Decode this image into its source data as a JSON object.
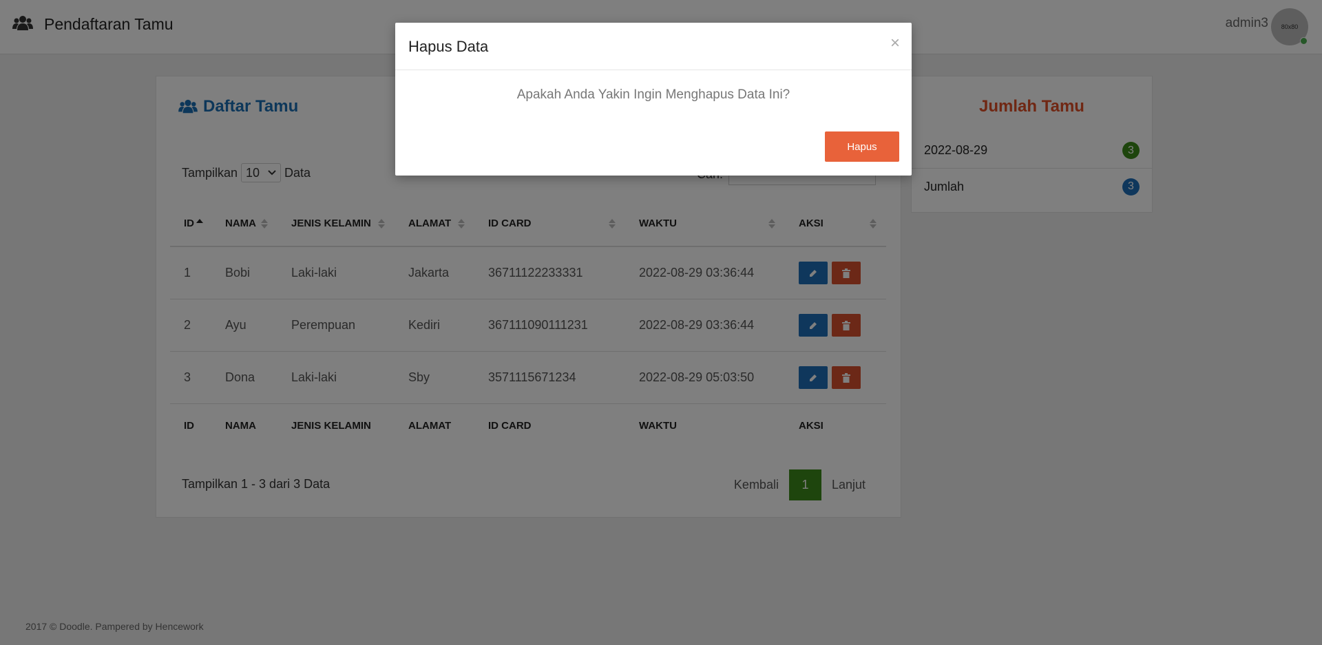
{
  "header": {
    "title": "Pendaftaran Tamu",
    "username": "admin3",
    "avatar_text": "80x80"
  },
  "main": {
    "title": "Daftar Tamu",
    "show_prefix": "Tampilkan",
    "show_value": "10",
    "show_suffix": "Data",
    "search_label": "Cari:",
    "columns": [
      "ID",
      "NAMA",
      "JENIS KELAMIN",
      "ALAMAT",
      "ID CARD",
      "WAKTU",
      "AKSI"
    ],
    "rows": [
      {
        "id": "1",
        "nama": "Bobi",
        "jk": "Laki-laki",
        "alamat": "Jakarta",
        "idcard": "36711122233331",
        "waktu": "2022-08-29 03:36:44"
      },
      {
        "id": "2",
        "nama": "Ayu",
        "jk": "Perempuan",
        "alamat": "Kediri",
        "idcard": "367111090111231",
        "waktu": "2022-08-29 03:36:44"
      },
      {
        "id": "3",
        "nama": "Dona",
        "jk": "Laki-laki",
        "alamat": "Sby",
        "idcard": "3571115671234",
        "waktu": "2022-08-29 05:03:50"
      }
    ],
    "info": "Tampilkan 1 - 3 dari 3 Data",
    "pager": {
      "prev": "Kembali",
      "current": "1",
      "next": "Lanjut"
    }
  },
  "side": {
    "title": "Jumlah Tamu",
    "items": [
      {
        "label": "2022-08-29",
        "count": "3",
        "color": "#3c8a1a"
      },
      {
        "label": "Jumlah",
        "count": "3",
        "color": "#1e6fb8"
      }
    ]
  },
  "footer": "2017 © Doodle. Pampered by Hencework",
  "modal": {
    "title": "Hapus Data",
    "close": "×",
    "message": "Apakah Anda Yakin Ingin Menghapus Data Ini?",
    "confirm": "Hapus"
  },
  "colors": {
    "primary": "#1e6fb8",
    "danger": "#d9502f",
    "success": "#3c8a1a",
    "accent": "#e8623a"
  }
}
